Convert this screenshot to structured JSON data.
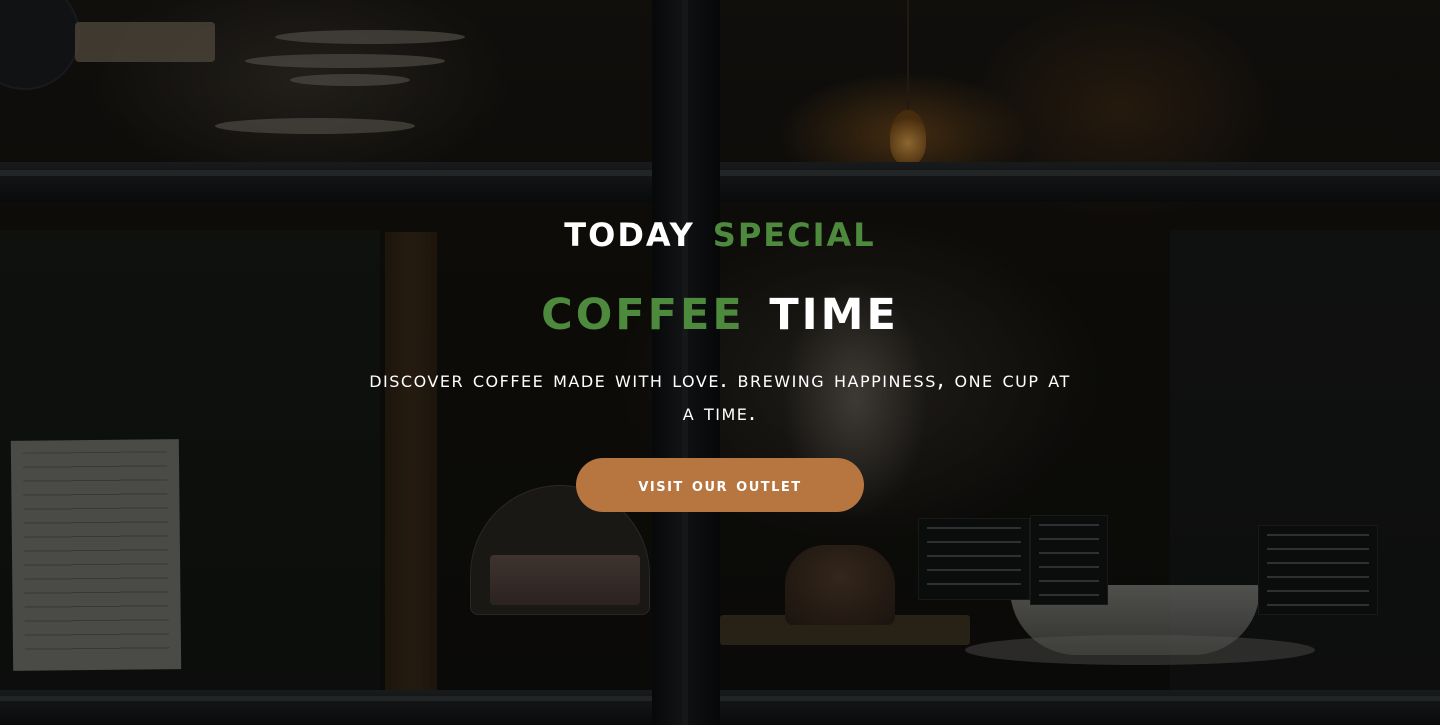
{
  "hero": {
    "headline_line1": {
      "part1": "TODAY",
      "part2": "SPECIAL"
    },
    "headline_line2": {
      "part1": "COFFEE",
      "part2": "TIME"
    },
    "tagline": "Discover coffee made with love. Brewing happiness, one cup at a time.",
    "cta_label": "VISIT OUR OUTLET"
  },
  "colors": {
    "accent_green": "#4e8a3e",
    "button_brown": "#b7753f",
    "text_white": "#ffffff"
  }
}
